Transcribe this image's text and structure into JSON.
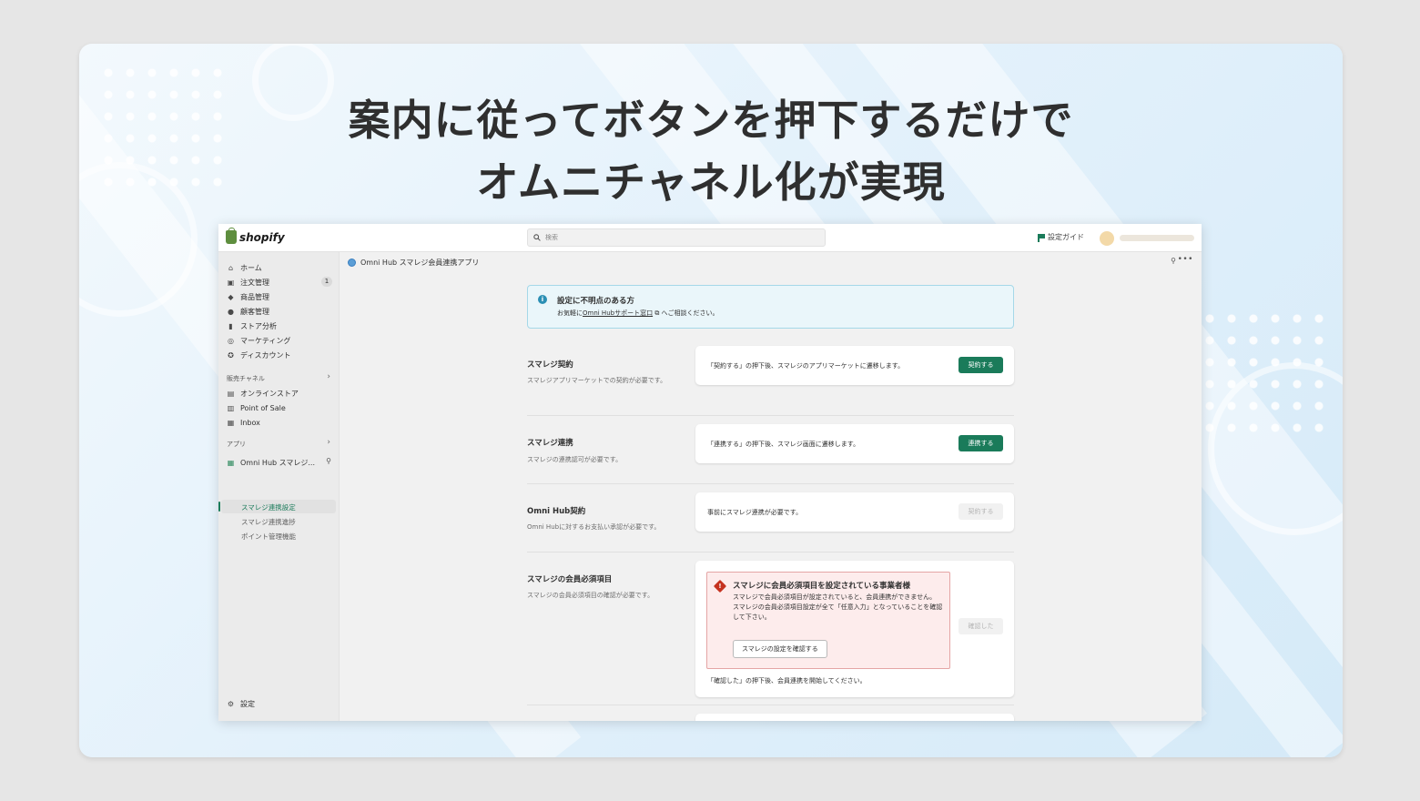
{
  "headline": {
    "line1": "案内に従ってボタンを押下するだけで",
    "line2": "オムニチャネル化が実現"
  },
  "topbar": {
    "logo_text": "shopify",
    "search_placeholder": "検索",
    "guide_label": "設定ガイド",
    "icons": [
      "shopify-bag-icon",
      "search-icon",
      "flag-icon"
    ]
  },
  "sidebar": {
    "items": [
      {
        "label": "ホーム",
        "icon": "home-icon"
      },
      {
        "label": "注文管理",
        "icon": "inbox-tray-icon",
        "badge": "1"
      },
      {
        "label": "商品管理",
        "icon": "tag-icon"
      },
      {
        "label": "顧客管理",
        "icon": "person-icon"
      },
      {
        "label": "ストア分析",
        "icon": "bar-chart-icon"
      },
      {
        "label": "マーケティング",
        "icon": "target-icon"
      },
      {
        "label": "ディスカウント",
        "icon": "discount-icon"
      }
    ],
    "sales_channels_label": "販売チャネル",
    "channels": [
      {
        "label": "オンラインストア",
        "icon": "store-icon"
      },
      {
        "label": "Point of Sale",
        "icon": "pos-icon"
      },
      {
        "label": "Inbox",
        "icon": "inbox-icon"
      }
    ],
    "apps_label": "アプリ",
    "app_name": "Omni Hub スマレジ...",
    "app_subitems": [
      "スマレジ連携設定",
      "スマレジ連携進捗",
      "ポイント管理機能"
    ],
    "settings_label": "設定"
  },
  "appbar": {
    "title": "Omni Hub スマレジ会員連携アプリ"
  },
  "banner": {
    "title": "設定に不明点のある方",
    "text_before": "お気軽に",
    "link": "Omni Hubサポート窓口",
    "text_after": "へご相談ください。"
  },
  "sections": [
    {
      "title": "スマレジ契約",
      "desc": "スマレジアプリマーケットでの契約が必要です。",
      "card_text": "「契約する」の押下後、スマレジのアプリマーケットに遷移します。",
      "button": "契約する",
      "button_state": "enabled"
    },
    {
      "title": "スマレジ連携",
      "desc": "スマレジの連携認可が必要です。",
      "card_text": "「連携する」の押下後、スマレジ画面に遷移します。",
      "button": "連携する",
      "button_state": "enabled"
    },
    {
      "title": "Omni Hub契約",
      "desc": "Omni Hubに対するお支払い承認が必要です。",
      "card_text": "事前にスマレジ連携が必要です。",
      "button": "契約する",
      "button_state": "disabled"
    },
    {
      "title": "スマレジの会員必須項目",
      "desc": "スマレジの会員必須項目の確認が必要です。",
      "critical": {
        "title": "スマレジに会員必須項目を設定されている事業者様",
        "line1": "スマレジで会員必須項目が設定されていると、会員連携ができません。",
        "line2": "スマレジの会員必須項目設定が全て「任意入力」となっていることを確認して下さい。",
        "button": "スマレジの設定を確認する"
      },
      "button": "確認した",
      "button_state": "disabled",
      "footnote": "「確認した」の押下後、会員連携を開始してください。"
    }
  ],
  "colors": {
    "primary_button": "#1a7b5a",
    "banner_bg": "#eaf6fa",
    "critical_bg": "#fdecec",
    "critical_border": "#e5a5a5",
    "slide_bg": "#e3f1fb"
  }
}
